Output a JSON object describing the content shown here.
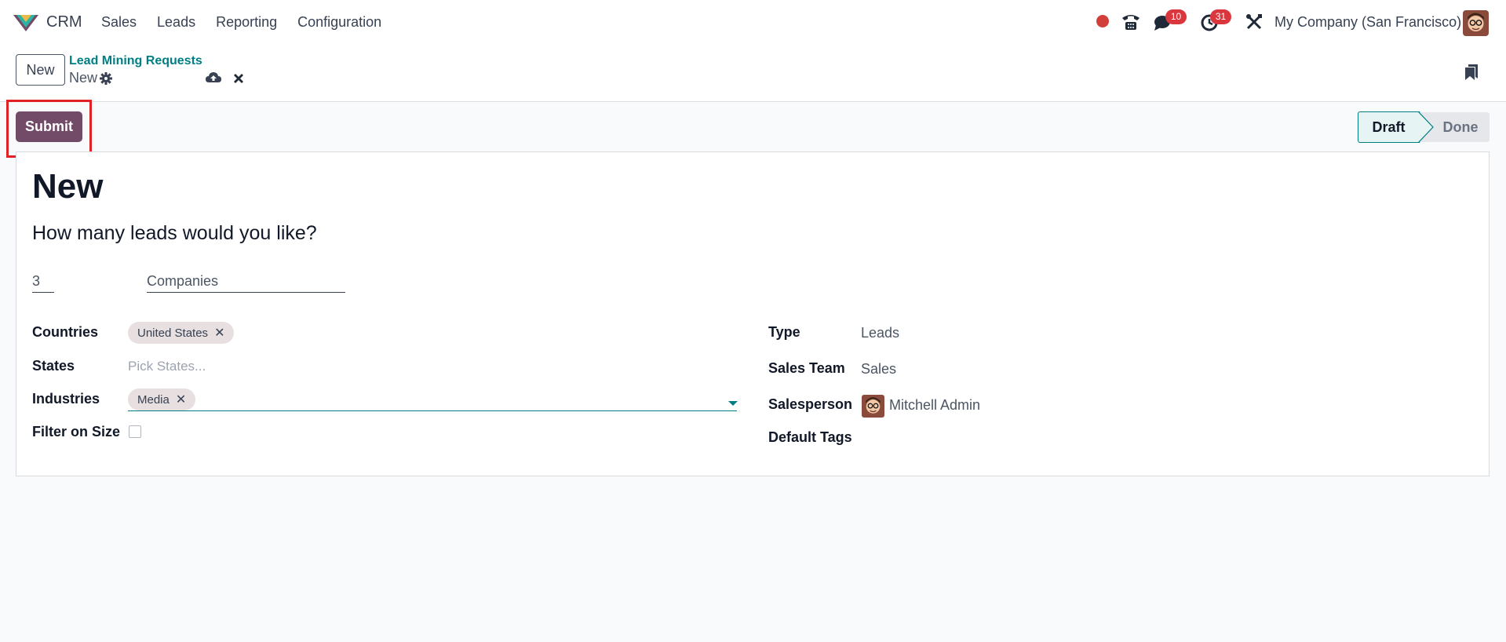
{
  "navbar": {
    "app_name": "CRM",
    "menu": [
      "Sales",
      "Leads",
      "Reporting",
      "Configuration"
    ],
    "chat_badge": "10",
    "activity_badge": "31",
    "company": "My Company (San Francisco)"
  },
  "control": {
    "new_label": "New",
    "breadcrumb": "Lead Mining Requests",
    "record_name": "New"
  },
  "status": {
    "submit_label": "Submit",
    "stages": [
      "Draft",
      "Done"
    ],
    "active_stage": "Draft"
  },
  "form": {
    "title": "New",
    "subtitle": "How many leads would you like?",
    "quantity": "3",
    "target": "Companies",
    "left": {
      "countries_label": "Countries",
      "countries_tag": "United States",
      "states_label": "States",
      "states_placeholder": "Pick States...",
      "industries_label": "Industries",
      "industries_tag": "Media",
      "filter_size_label": "Filter on Size"
    },
    "right": {
      "type_label": "Type",
      "type_value": "Leads",
      "team_label": "Sales Team",
      "team_value": "Sales",
      "salesperson_label": "Salesperson",
      "salesperson_value": "Mitchell Admin",
      "tags_label": "Default Tags"
    }
  },
  "colors": {
    "primary": "#714b67",
    "accent": "#017e84",
    "highlight": "#e02226",
    "badge": "#d9363e"
  },
  "icons": [
    "app-logo-icon",
    "record-dot-icon",
    "phone-icon",
    "chat-icon",
    "clock-icon",
    "tools-icon",
    "gear-icon",
    "cloud-save-icon",
    "discard-icon",
    "bookmark-icon",
    "close-icon",
    "chevron-down-icon"
  ]
}
